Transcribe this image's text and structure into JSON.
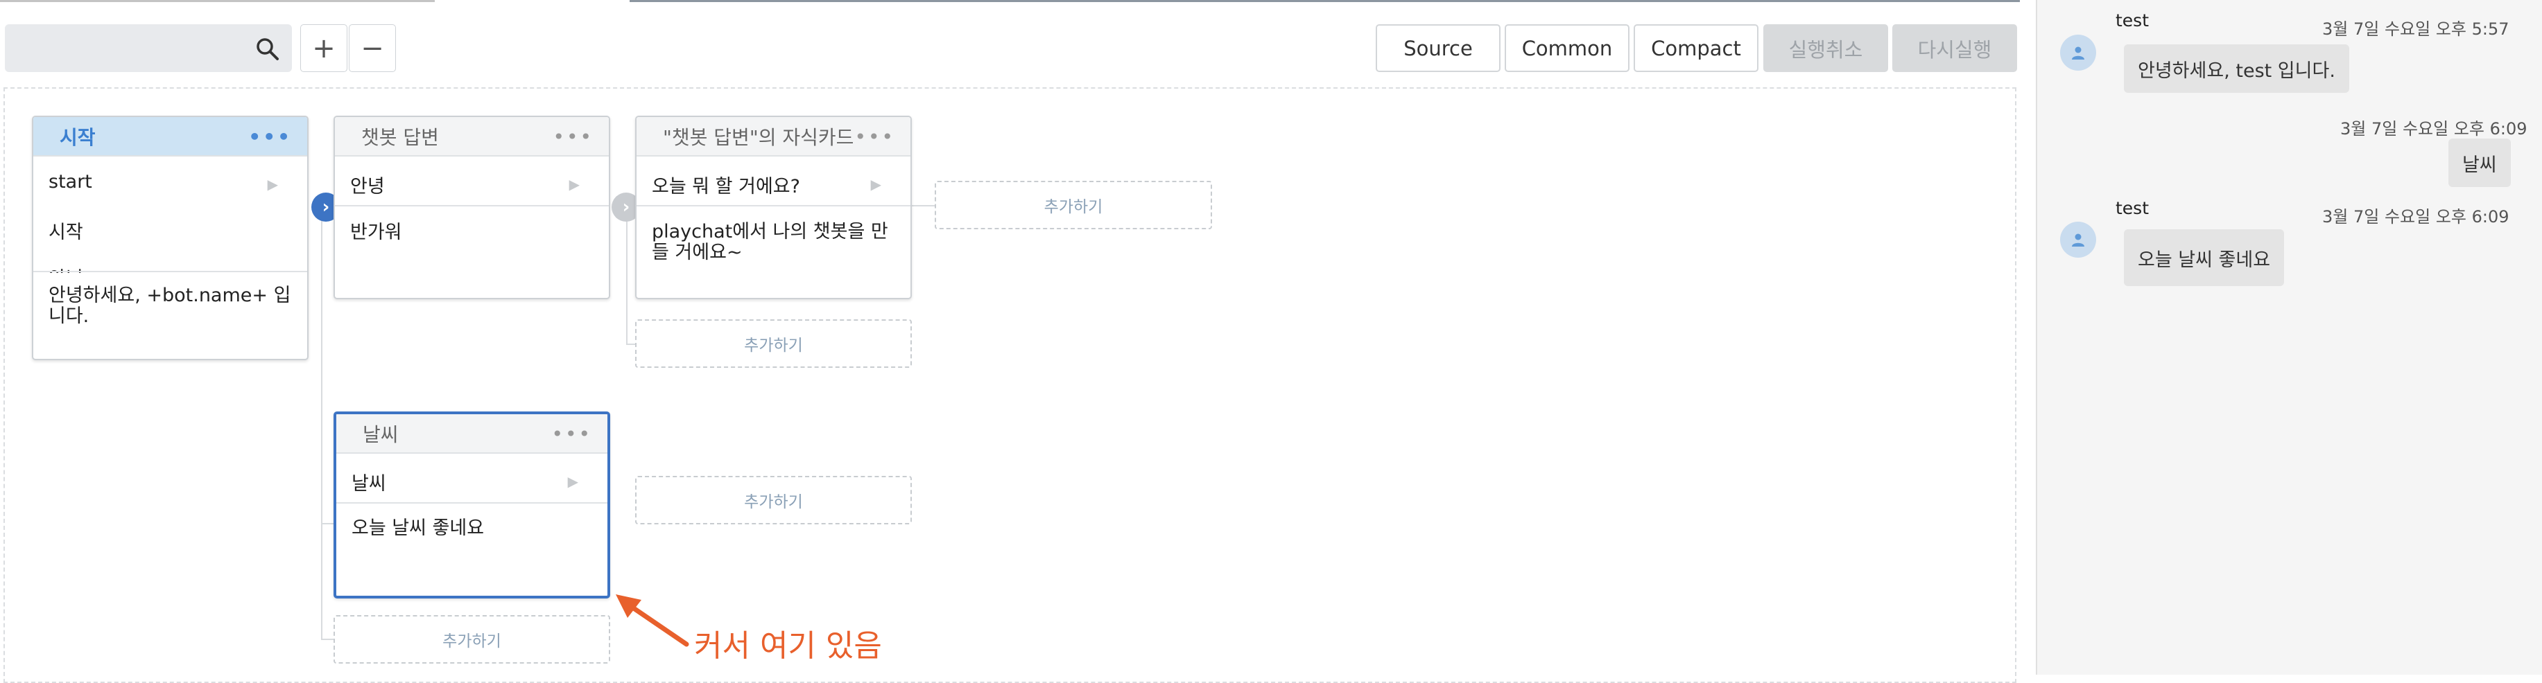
{
  "toolbar": {
    "search_placeholder": "",
    "zoom_in_label": "+",
    "zoom_out_label": "−",
    "buttons": [
      "Source",
      "Common",
      "Compact",
      "실행취소",
      "다시실행"
    ]
  },
  "cards": {
    "start": {
      "title": "시작",
      "rows": [
        "start",
        "시작",
        "안녕"
      ],
      "response": "안녕하세요, +bot.name+ 입니다."
    },
    "chatbot": {
      "title": "챗봇 답변",
      "rows": [
        "안녕"
      ],
      "response": "반가워"
    },
    "child": {
      "title": "\"챗봇 답변\"의 자식카드",
      "rows": [
        "오늘 뭐 할 거에요?"
      ],
      "response": "playchat에서 나의 챗봇을 만들 거에요~"
    },
    "weather": {
      "title": "날씨",
      "rows": [
        "날씨"
      ],
      "response": "오늘 날씨 좋네요"
    }
  },
  "add_label": "추가하기",
  "annotation": "커서 여기 있음",
  "colors": {
    "accent": "#3d74c4",
    "start_header": "#cde3f4",
    "annotation": "#e8602c"
  },
  "chat": {
    "messages": [
      {
        "sender": "test",
        "time": "3월 7일 수요일 오후 5:57",
        "text": "안녕하세요, test 입니다.",
        "side": "bot"
      },
      {
        "sender": "",
        "time": "3월 7일 수요일 오후 6:09",
        "text": "날씨",
        "side": "user"
      },
      {
        "sender": "test",
        "time": "3월 7일 수요일 오후 6:09",
        "text": "오늘 날씨 좋네요",
        "side": "bot"
      }
    ]
  }
}
